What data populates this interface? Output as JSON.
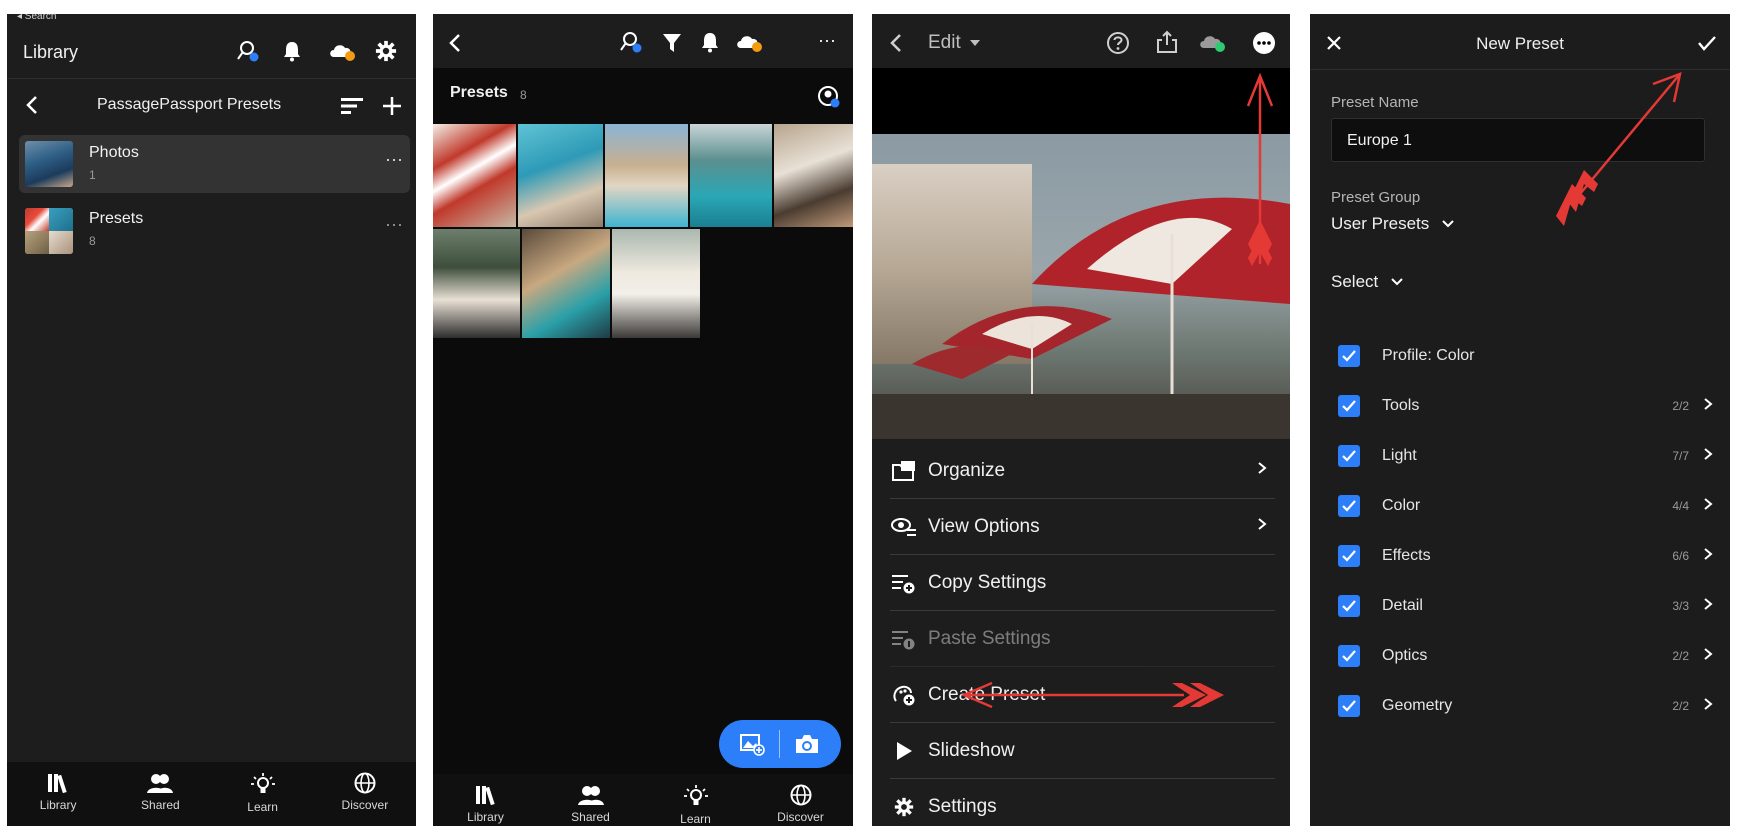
{
  "panel1": {
    "search_back": "◂ Search",
    "title": "Library",
    "album_title": "PassagePassport Presets",
    "items": [
      {
        "label": "Photos",
        "count": "1"
      },
      {
        "label": "Presets",
        "count": "8"
      }
    ],
    "more": "···"
  },
  "nav": {
    "library": "Library",
    "shared": "Shared",
    "learn": "Learn",
    "discover": "Discover"
  },
  "panel2": {
    "section_title": "Presets",
    "section_count": "8",
    "more": "···"
  },
  "panel3": {
    "edit_label": "Edit",
    "menu": [
      {
        "label": "Organize",
        "icon": "organize-icon"
      },
      {
        "label": "View Options",
        "icon": "view-options-icon"
      },
      {
        "label": "Copy Settings",
        "icon": "copy-settings-icon"
      },
      {
        "label": "Paste Settings",
        "icon": "paste-settings-icon"
      },
      {
        "label": "Create Preset",
        "icon": "create-preset-icon"
      },
      {
        "label": "Slideshow",
        "icon": "play-icon"
      },
      {
        "label": "Settings",
        "icon": "gear-icon"
      }
    ]
  },
  "panel4": {
    "title": "New Preset",
    "preset_name_label": "Preset Name",
    "preset_name_value": "Europe 1",
    "preset_group_label": "Preset Group",
    "preset_group_value": "User Presets",
    "select_label": "Select",
    "options": [
      {
        "label": "Profile: Color",
        "count": ""
      },
      {
        "label": "Tools",
        "count": "2/2"
      },
      {
        "label": "Light",
        "count": "7/7"
      },
      {
        "label": "Color",
        "count": "4/4"
      },
      {
        "label": "Effects",
        "count": "6/6"
      },
      {
        "label": "Detail",
        "count": "3/3"
      },
      {
        "label": "Optics",
        "count": "2/2"
      },
      {
        "label": "Geometry",
        "count": "2/2"
      }
    ]
  },
  "colors": {
    "accent_blue": "#2d7ff9",
    "annotation_red": "#e53935",
    "badge_orange": "#f39c12",
    "cloud_green": "#2ecc71"
  }
}
